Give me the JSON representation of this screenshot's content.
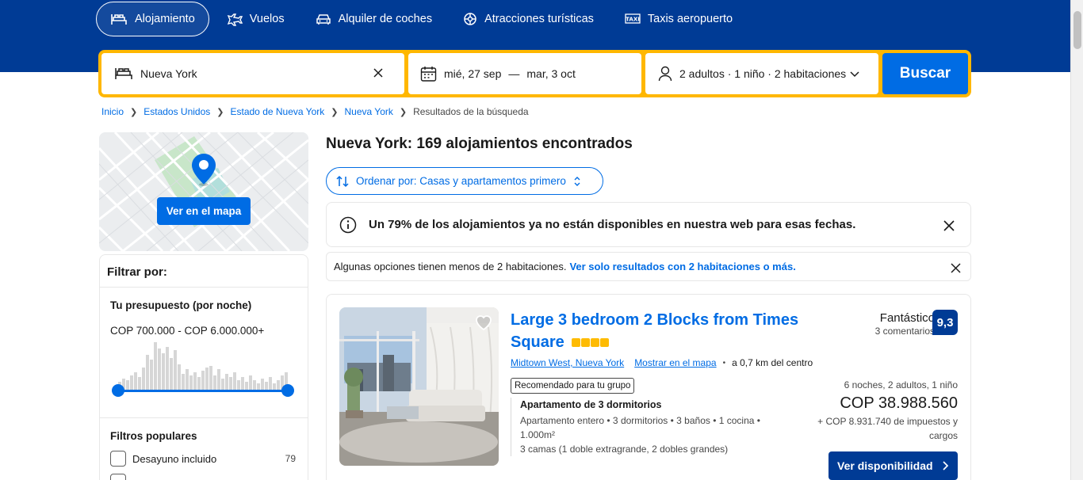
{
  "nav": {
    "items": [
      {
        "label": "Alojamiento",
        "icon": "bed-icon",
        "active": true
      },
      {
        "label": "Vuelos",
        "icon": "plane-icon",
        "active": false
      },
      {
        "label": "Alquiler de coches",
        "icon": "car-icon",
        "active": false
      },
      {
        "label": "Atracciones turísticas",
        "icon": "attractions-icon",
        "active": false
      },
      {
        "label": "Taxis aeropuerto",
        "icon": "taxi-icon",
        "active": false
      }
    ]
  },
  "search": {
    "destination": "Nueva York",
    "checkin": "mié, 27 sep",
    "dates_separator": "—",
    "checkout": "mar, 3 oct",
    "guests": "2 adultos · 1 niño · 2 habitaciones",
    "button": "Buscar"
  },
  "breadcrumb": {
    "items": [
      "Inicio",
      "Estados Unidos",
      "Estado de Nueva York",
      "Nueva York"
    ],
    "current": "Resultados de la búsqueda"
  },
  "map": {
    "button": "Ver en el mapa"
  },
  "filters": {
    "title": "Filtrar por:",
    "budget_title": "Tu presupuesto (por noche)",
    "budget_range": "COP 700.000 - COP 6.000.000+",
    "budget_min_fraction": 0.0,
    "budget_max_fraction": 1.0,
    "popular_title": "Filtros populares",
    "popular": [
      {
        "label": "Desayuno incluido",
        "count": "79"
      }
    ]
  },
  "results": {
    "title": "Nueva York: 169 alojamientos encontrados",
    "sort_label": "Ordenar por: Casas y apartamentos primero"
  },
  "alert": {
    "text": "Un 79% de los alojamientos ya no están disponibles en nuestra web para esas fechas."
  },
  "notice": {
    "text": "Algunas opciones tienen menos de 2 habitaciones.",
    "link": "Ver solo resultados con 2 habitaciones o más."
  },
  "listing": {
    "title": "Large 3 bedroom 2 Blocks from Times Square",
    "stars": 4,
    "location": "Midtown West, Nueva York",
    "map_link": "Mostrar en el mapa",
    "distance": "a 0,7 km del centro",
    "tag": "Recomendado para tu grupo",
    "unit_title": "Apartamento de 3 dormitorios",
    "unit_details": "Apartamento entero • 3 dormitorios • 3 baños • 1 cocina • 1.000m²",
    "beds": "3 camas (1 doble extragrande, 2 dobles grandes)",
    "rating_label": "Fantástico",
    "reviews": "3 comentarios",
    "score": "9,3",
    "stay_info": "6 noches, 2 adultos, 1 niño",
    "price": "COP 38.988.560",
    "taxes": "+ COP 8.931.740 de impuestos y cargos",
    "cta": "Ver disponibilidad"
  },
  "colors": {
    "brand_dark": "#003b95",
    "brand_blue": "#006ce4",
    "search_border": "#ffb700",
    "star": "#febb02"
  }
}
